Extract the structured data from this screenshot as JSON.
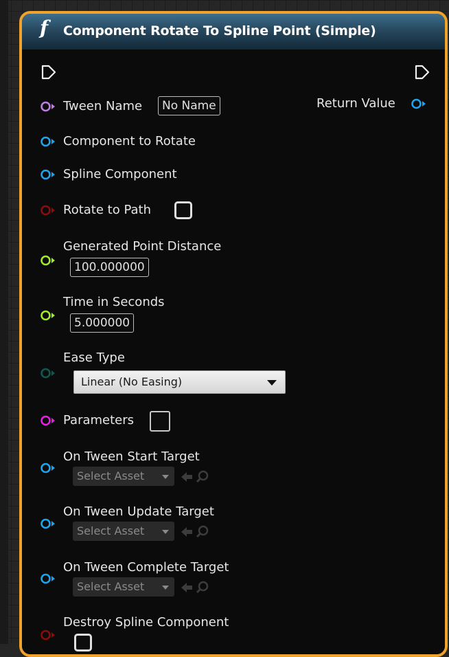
{
  "node": {
    "title": "Component Rotate To Spline Point (Simple)",
    "function_glyph": "f",
    "header_color": "#2f5a76",
    "border_color": "#f0a32b"
  },
  "inputs": {
    "tween_name": {
      "label": "Tween Name",
      "value": "No Name",
      "pin_color": "#c07ce6"
    },
    "component_to_rotate": {
      "label": "Component to Rotate",
      "pin_color": "#1ea4ee"
    },
    "spline_component": {
      "label": "Spline Component",
      "pin_color": "#1ea4ee"
    },
    "rotate_to_path": {
      "label": "Rotate to Path",
      "checked": false,
      "pin_color": "#8e0b0b"
    },
    "generated_point_distance": {
      "label": "Generated Point Distance",
      "value": "100.000000",
      "pin_color": "#a0ea2a"
    },
    "time_in_seconds": {
      "label": "Time in Seconds",
      "value": "5.000000",
      "pin_color": "#a0ea2a"
    },
    "ease_type": {
      "label": "Ease Type",
      "selected": "Linear (No Easing)",
      "pin_color": "#0b5a52"
    },
    "parameters": {
      "label": "Parameters",
      "checked": false,
      "pin_color": "#e61ee6"
    },
    "on_tween_start_target": {
      "label": "On Tween Start Target",
      "asset_label": "Select Asset",
      "pin_color": "#1ea4ee"
    },
    "on_tween_update_target": {
      "label": "On Tween Update Target",
      "asset_label": "Select Asset",
      "pin_color": "#1ea4ee"
    },
    "on_tween_complete_target": {
      "label": "On Tween Complete Target",
      "asset_label": "Select Asset",
      "pin_color": "#1ea4ee"
    },
    "destroy_spline_component": {
      "label": "Destroy Spline Component",
      "checked": false,
      "pin_color": "#8e0b0b"
    }
  },
  "outputs": {
    "return_value": {
      "label": "Return Value",
      "pin_color": "#1ea4ee"
    }
  },
  "icons": {
    "exec_in": "exec-pin-icon",
    "exec_out": "exec-pin-icon",
    "pin": "pin-circle-icon",
    "browse": "arrow-left-icon",
    "search": "search-icon",
    "dropdown": "chevron-down-icon"
  }
}
